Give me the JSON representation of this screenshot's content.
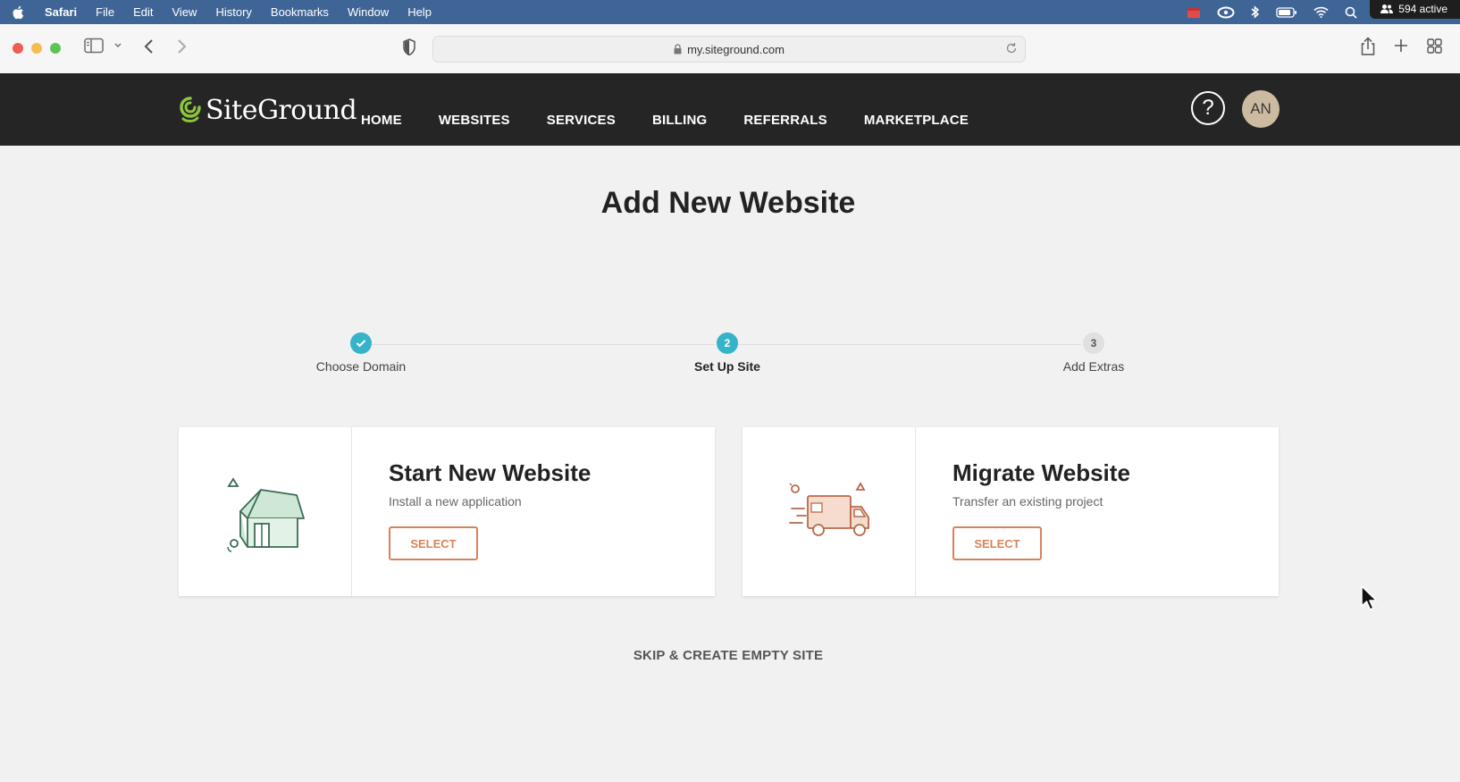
{
  "menubar": {
    "app": "Safari",
    "items": [
      "File",
      "Edit",
      "View",
      "History",
      "Bookmarks",
      "Window",
      "Help"
    ],
    "active_count": "594 active"
  },
  "toolbar": {
    "url": "my.siteground.com"
  },
  "site": {
    "brand": "SiteGround",
    "nav": [
      "HOME",
      "WEBSITES",
      "SERVICES",
      "BILLING",
      "REFERRALS",
      "MARKETPLACE"
    ],
    "help": "?",
    "avatar_initials": "AN"
  },
  "main": {
    "title": "Add New Website",
    "steps": [
      {
        "label": "Choose Domain",
        "state": "done",
        "marker": ""
      },
      {
        "label": "Set Up Site",
        "state": "current",
        "marker": "2"
      },
      {
        "label": "Add Extras",
        "state": "upcoming",
        "marker": "3"
      }
    ],
    "cards": [
      {
        "title": "Start New Website",
        "subtitle": "Install a new application",
        "button": "SELECT",
        "icon": "house-icon"
      },
      {
        "title": "Migrate Website",
        "subtitle": "Transfer an existing project",
        "button": "SELECT",
        "icon": "moving-truck-icon"
      }
    ],
    "skip_link": "SKIP & CREATE EMPTY SITE"
  },
  "colors": {
    "menubar": "#3f6597",
    "header": "#252525",
    "accent_teal": "#36b3c9",
    "accent_orange": "#d8825b",
    "page_bg": "#f1f1f1"
  }
}
